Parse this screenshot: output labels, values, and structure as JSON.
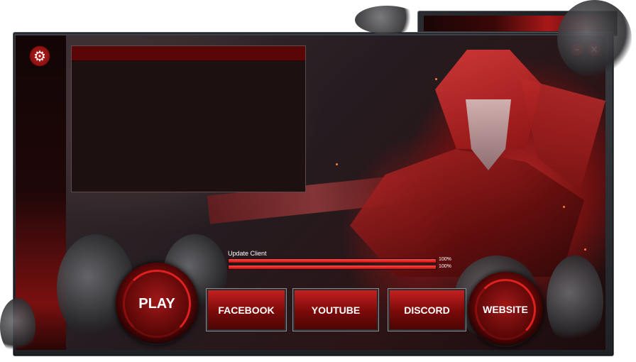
{
  "buttons": {
    "play": "PLAY",
    "facebook": "FACEBOOK",
    "youtube": "YOUTUBE",
    "discord": "DISCORD",
    "website": "WEBSITE"
  },
  "update": {
    "label": "Update Client",
    "file_progress": "100%",
    "total_progress": "100%",
    "file_fraction": 1.0,
    "total_fraction": 1.0
  },
  "window_controls": {
    "minimize": "–",
    "close": "✕"
  },
  "icons": {
    "settings": "⚙"
  },
  "colors": {
    "accent": "#c41e1e",
    "frame": "#3a3d43",
    "news_header": "#5b0606",
    "news_body": "#1c1011"
  }
}
